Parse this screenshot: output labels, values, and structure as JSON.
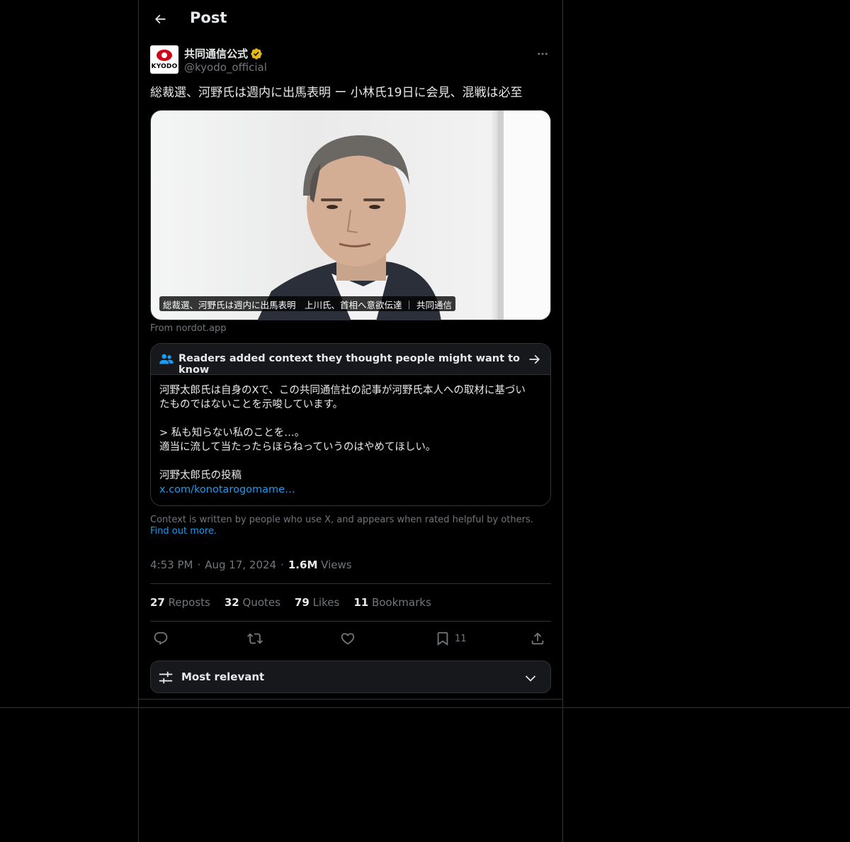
{
  "header": {
    "title": "Post"
  },
  "author": {
    "avatar_text": "KYODO",
    "name": "共同通信公式",
    "handle": "@kyodo_official"
  },
  "post": {
    "text": "総裁選、河野氏は週内に出馬表明 ー 小林氏19日に会見、混戦は必至",
    "media_caption": "総裁選、河野氏は週内に出馬表明　上川氏、首相へ意欲伝達 ｜ 共同通信",
    "source": "From nordot.app"
  },
  "community_note": {
    "title": "Readers added context they thought people might want to know",
    "body_lines": [
      "河野太郎氏は自身のXで、この共同通信社の記事が河野氏本人への取材に基づい",
      "たものではないことを示唆しています。",
      "> 私も知らない私のことを…。",
      "適当に流して当たったらほらねっていうのはやめてほしい。",
      "河野太郎氏の投稿"
    ],
    "link": "x.com/konotarogomame…"
  },
  "context_footer": {
    "text": "Context is written by people who use X, and appears when rated helpful by others.",
    "link": "Find out more."
  },
  "meta": {
    "time": "4:53 PM",
    "date": "Aug 17, 2024",
    "views_count": "1.6M",
    "views_label": "Views",
    "separator": "·"
  },
  "stats": [
    {
      "count": "27",
      "label": "Reposts"
    },
    {
      "count": "32",
      "label": "Quotes"
    },
    {
      "count": "79",
      "label": "Likes"
    },
    {
      "count": "11",
      "label": "Bookmarks"
    }
  ],
  "actions": {
    "bookmark_count": "11"
  },
  "sort": {
    "label": "Most relevant"
  },
  "colors": {
    "background": "#000000",
    "border": "#2f3336",
    "text": "#e7e9ea",
    "muted": "#71767b",
    "link": "#1d9bf0",
    "verified": "#e2b719"
  },
  "icons": {
    "back": "arrow-left-icon",
    "verified": "verified-badge-icon",
    "more": "more-horizontal-icon",
    "people": "people-icon",
    "note_arrow": "arrow-right-icon",
    "reply": "reply-icon",
    "repost": "repost-icon",
    "like": "heart-icon",
    "bookmark": "bookmark-icon",
    "share": "share-icon",
    "sort": "sliders-icon",
    "chevron": "chevron-down-icon"
  }
}
